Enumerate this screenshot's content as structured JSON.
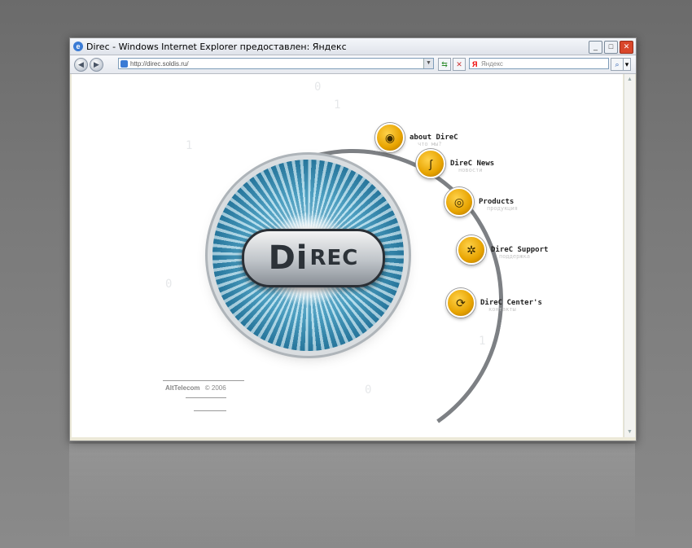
{
  "window": {
    "title": "Direc - Windows Internet Explorer предоставлен: Яндекс",
    "buttons": {
      "minimize": "_",
      "maximize": "□",
      "close": "✕"
    }
  },
  "toolbar": {
    "address": "http://direc.soldis.ru/",
    "search_placeholder": "Яндекс",
    "search_logo": "Я"
  },
  "site": {
    "logo_di": "Di",
    "logo_rec": "REC",
    "menu": [
      {
        "label": "about DireC",
        "sub": "что мы?",
        "icon": "eye-icon"
      },
      {
        "label": "DireC News",
        "sub": "новости",
        "icon": "ear-icon"
      },
      {
        "label": "Products",
        "sub": "продукция",
        "icon": "target-icon"
      },
      {
        "label": "DireC Support",
        "sub": "поддержка",
        "icon": "web-icon"
      },
      {
        "label": "DireC Center's",
        "sub": "контакты",
        "icon": "refresh-icon"
      }
    ],
    "footer": {
      "company": "AltTelecom",
      "copyright": "© 2006"
    }
  }
}
